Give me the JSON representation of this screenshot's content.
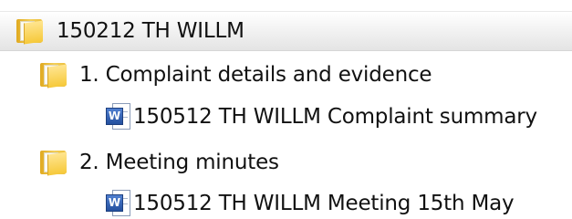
{
  "tree": {
    "root": {
      "label": "150212 TH WILLM",
      "icon": "folder-icon"
    },
    "folders": [
      {
        "label": "1. Complaint details and evidence",
        "icon": "folder-icon",
        "files": [
          {
            "label": "150512 TH WILLM Complaint summary",
            "icon": "word-document-icon",
            "badge": "W"
          }
        ]
      },
      {
        "label": "2. Meeting minutes",
        "icon": "folder-icon",
        "files": [
          {
            "label": "150512 TH WILLM Meeting 15th May",
            "icon": "word-document-icon",
            "badge": "W"
          }
        ]
      }
    ],
    "colors": {
      "folder": "#f3c94a",
      "word_badge": "#2f5eb5",
      "selection": "#e8e8e8",
      "text": "#111111"
    }
  }
}
